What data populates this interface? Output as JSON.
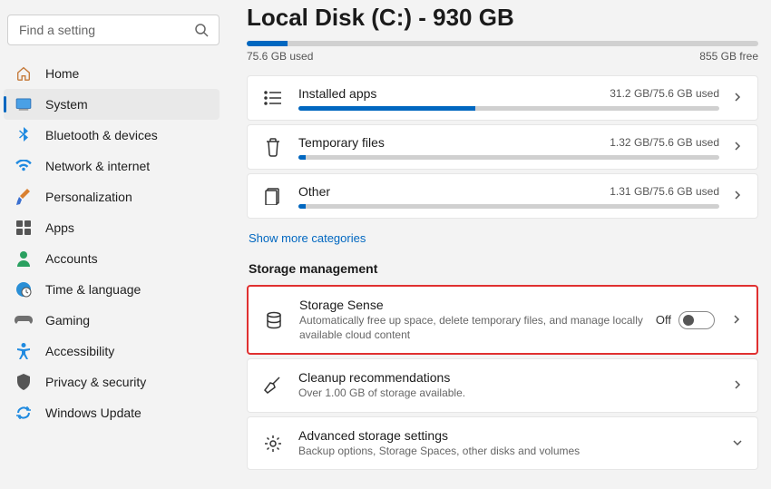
{
  "search": {
    "placeholder": "Find a setting"
  },
  "nav": [
    {
      "label": "Home"
    },
    {
      "label": "System"
    },
    {
      "label": "Bluetooth & devices"
    },
    {
      "label": "Network & internet"
    },
    {
      "label": "Personalization"
    },
    {
      "label": "Apps"
    },
    {
      "label": "Accounts"
    },
    {
      "label": "Time & language"
    },
    {
      "label": "Gaming"
    },
    {
      "label": "Accessibility"
    },
    {
      "label": "Privacy & security"
    },
    {
      "label": "Windows Update"
    }
  ],
  "page": {
    "title": "Local Disk (C:) - 930 GB",
    "used": "75.6 GB used",
    "free": "855 GB free",
    "fillPct": "8%"
  },
  "categories": [
    {
      "title": "Installed apps",
      "usage": "31.2 GB/75.6 GB used",
      "fillPct": "42%"
    },
    {
      "title": "Temporary files",
      "usage": "1.32 GB/75.6 GB used",
      "fillPct": "1.8%"
    },
    {
      "title": "Other",
      "usage": "1.31 GB/75.6 GB used",
      "fillPct": "1.8%"
    }
  ],
  "moreLink": "Show more categories",
  "sectionHeading": "Storage management",
  "mgmt": {
    "sense": {
      "title": "Storage Sense",
      "sub": "Automatically free up space, delete temporary files, and manage locally available cloud content",
      "toggleLabel": "Off"
    },
    "cleanup": {
      "title": "Cleanup recommendations",
      "sub": "Over 1.00 GB of storage available."
    },
    "advanced": {
      "title": "Advanced storage settings",
      "sub": "Backup options, Storage Spaces, other disks and volumes"
    }
  }
}
